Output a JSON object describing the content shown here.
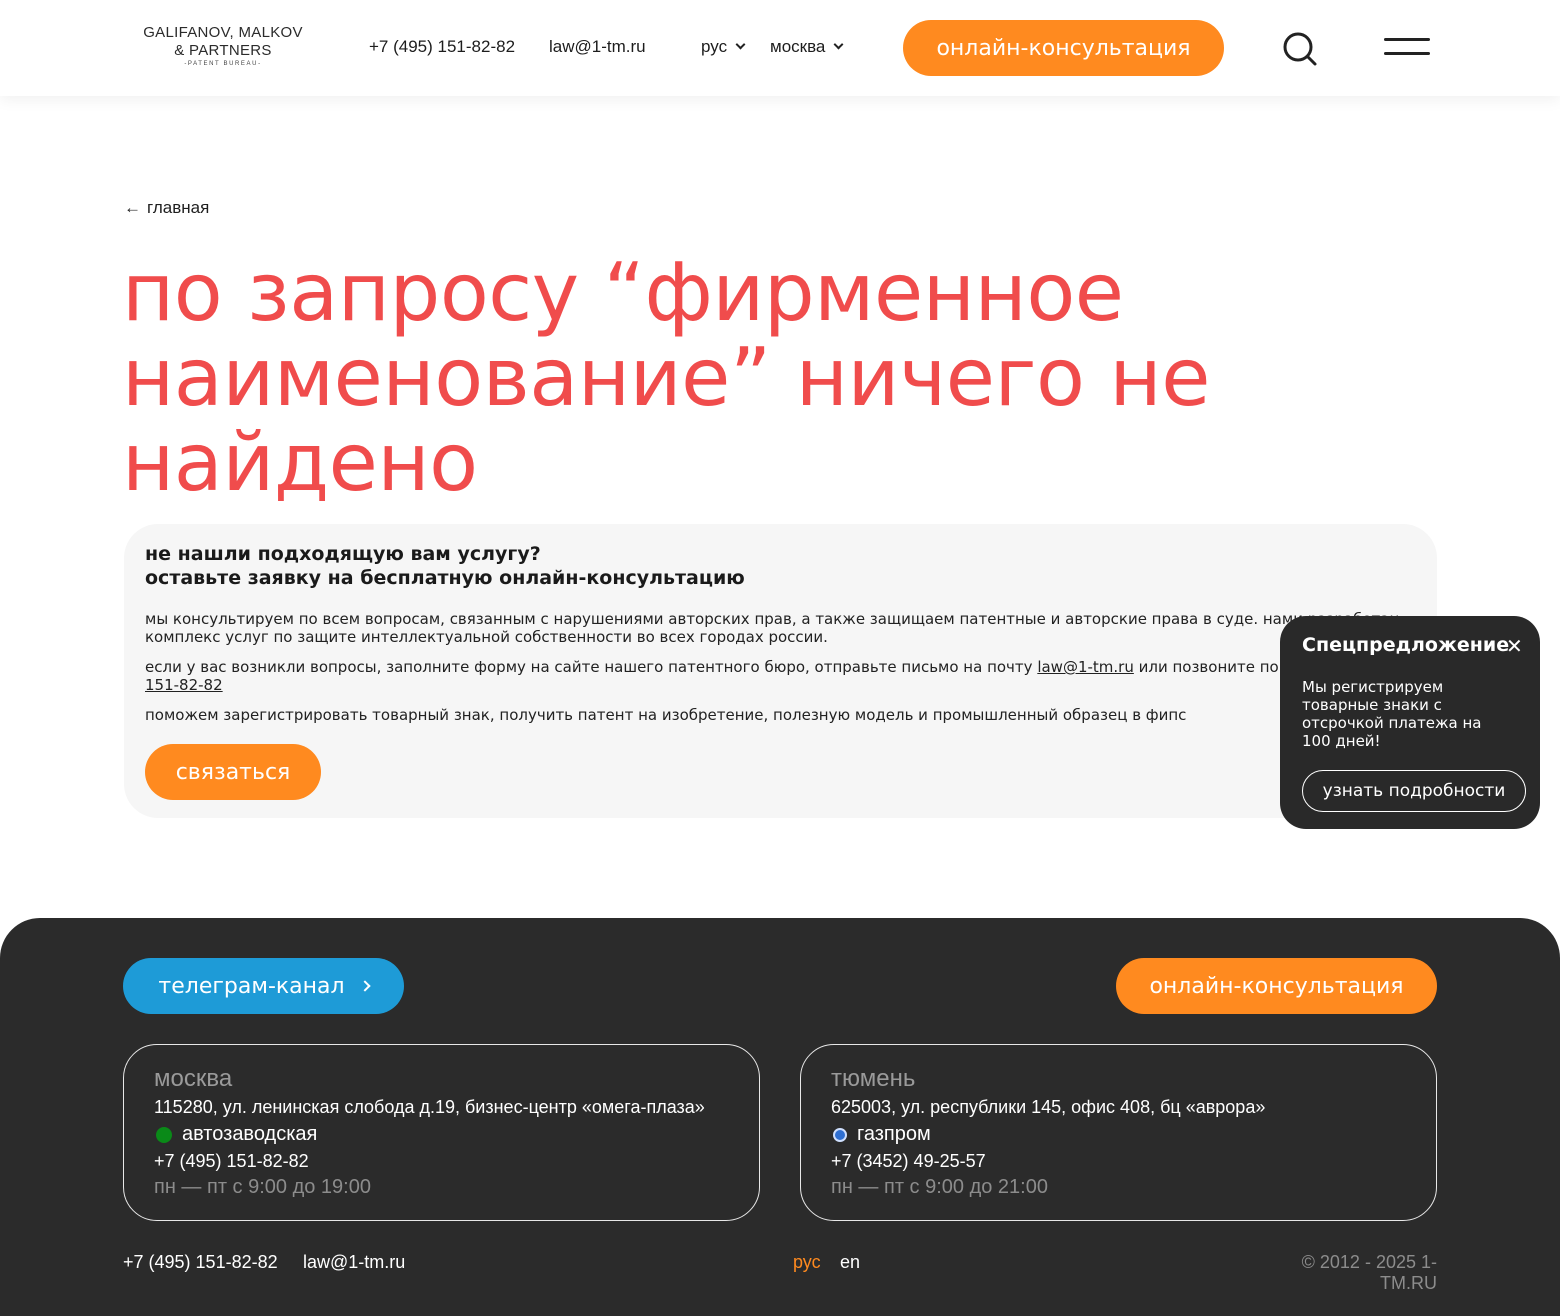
{
  "header": {
    "logo": {
      "line1": "GALIFANOV, MALKOV",
      "line2": "& PARTNERS",
      "line3": "-PATENT BUREAU-"
    },
    "phone": "+7 (495) 151-82-82",
    "email": "law@1-tm.ru",
    "language": "рус",
    "city": "москва",
    "cta_label": "онлайн-консультация"
  },
  "main": {
    "back_label": "главная",
    "headline": "по запросу “фирменное наименование” ничего не найдено",
    "card": {
      "title_line1": "не нашли подходящую вам услугу?",
      "title_line2": "оставьте заявку на бесплатную онлайн-консультацию",
      "p1": "мы консультируем по всем вопросам, связанным с нарушениями авторских прав, а также защищаем патентные и авторские права в суде. нами разработан комплекс услуг по защите интеллектуальной собственности во всех городах россии.",
      "p2_before": "если у вас возникли вопросы, заполните форму на сайте нашего патентного бюро, отправьте письмо на почту ",
      "p2_email": "law@1-tm.ru",
      "p2_middle": " или позвоните по номеру ",
      "p2_phone": "+7 (495) 151-82-82",
      "p3": "поможем зарегистрировать товарный знак, получить патент на изобретение, полезную модель и промышленный образец в фипс",
      "button_label": "связаться"
    }
  },
  "popup": {
    "title": "Спецпредложение",
    "text": "Мы регистрируем товарные знаки с отсрочкой платежа на 100 дней!",
    "button_label": "узнать подробности"
  },
  "footer": {
    "telegram_label": "телеграм-канал",
    "cta_label": "онлайн-консультация",
    "offices": [
      {
        "city": "москва",
        "address": "115280, ул. ленинская слобода д.19, бизнес-центр «омега-плаза»",
        "metro": "автозаводская",
        "phone": "+7 (495) 151-82-82",
        "hours": "пн — пт с 9:00 до 19:00"
      },
      {
        "city": "тюмень",
        "address": "625003, ул. республики 145, офис 408, бц «аврора»",
        "metro": "газпром",
        "phone": "+7 (3452) 49-25-57",
        "hours": "пн — пт с 9:00 до 21:00"
      }
    ],
    "phone": "+7 (495) 151-82-82",
    "email": "law@1-tm.ru",
    "lang_ru": "рус",
    "lang_en": "en",
    "copyright": "© 2012 - 2025 1-TM.RU"
  },
  "colors": {
    "accent_orange": "#ff8a1f",
    "headline_red": "#f04c4c",
    "telegram_blue": "#1e9bd7",
    "footer_bg": "#2b2b2b",
    "metro_green": "#0a8a18"
  },
  "icons": [
    "search-icon",
    "menu-icon",
    "arrow-left-icon",
    "close-icon",
    "chevron-down-icon",
    "chevron-right-icon",
    "metro-icon",
    "gazprom-icon"
  ]
}
